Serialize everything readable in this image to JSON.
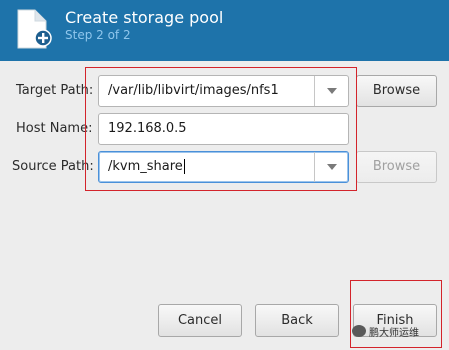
{
  "header": {
    "title": "Create storage pool",
    "step": "Step 2 of 2",
    "icon": "new-file-icon"
  },
  "form": {
    "target_path": {
      "label": "Target Path:",
      "value": "/var/lib/libvirt/images/nfs1",
      "browse": "Browse",
      "browse_enabled": true
    },
    "host_name": {
      "label": "Host Name:",
      "value": "192.168.0.5"
    },
    "source_path": {
      "label": "Source Path:",
      "value": "/kvm_share",
      "browse": "Browse",
      "browse_enabled": false
    }
  },
  "buttons": {
    "cancel": "Cancel",
    "back": "Back",
    "finish": "Finish"
  },
  "watermark": {
    "text": "鹏大师运维"
  },
  "colors": {
    "header_bg": "#1e73aa",
    "step_text": "#8fc6ec",
    "highlight_box": "#d3242b",
    "focus": "#4a90d9"
  }
}
